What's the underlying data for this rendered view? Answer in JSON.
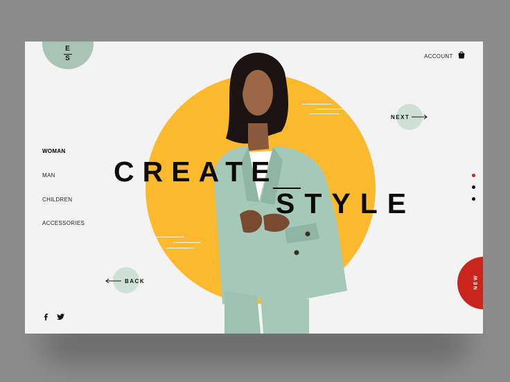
{
  "brand": {
    "logo_top": "E",
    "logo_bottom": "S"
  },
  "header": {
    "account_label": "ACCOUNT"
  },
  "nav": {
    "items": [
      {
        "label": "WOMAN"
      },
      {
        "label": "MAN"
      },
      {
        "label": "CHILDREN"
      },
      {
        "label": "ACCESSORIES"
      }
    ]
  },
  "hero": {
    "word1": "CREATE",
    "word2": "STYLE",
    "next_label": "NEXT",
    "back_label": "BACK"
  },
  "badge": {
    "new_label": "NEW"
  },
  "pagination": {
    "count": 3,
    "active_index": 0
  },
  "colors": {
    "accent": "#fbb92d",
    "badge": "#c8251d",
    "mint": "#a9c4b4",
    "active_dot": "#c8251d"
  },
  "icons": [
    "bag-icon",
    "arrow-right-icon",
    "arrow-left-icon",
    "facebook-icon",
    "twitter-icon"
  ]
}
